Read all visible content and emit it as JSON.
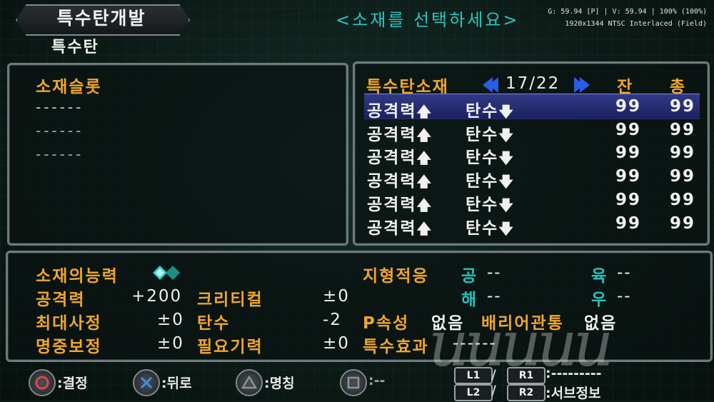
{
  "header": {
    "title": "특수탄개발",
    "subtitle": "특수탄",
    "prompt": "<소재를 선택하세요>",
    "overlay_line1": "G: 59.94 [P] | V: 59.94 | 100% (100%)",
    "overlay_line2": "1920x1344 NTSC Interlaced (Field)"
  },
  "material_slots": {
    "title": "소재슬롯",
    "slots": [
      "------",
      "------",
      "------"
    ]
  },
  "material_list": {
    "title": "특수탄소재",
    "page": "17/22",
    "col_remaining": "잔",
    "col_total": "총",
    "up_arrow": "🡅",
    "down_arrow": "🡇",
    "rows": [
      {
        "stat1": "공격력",
        "stat2": "탄수",
        "remaining": "99",
        "total": "99",
        "selected": true
      },
      {
        "stat1": "공격력",
        "stat2": "탄수",
        "remaining": "99",
        "total": "99",
        "selected": false
      },
      {
        "stat1": "공격력",
        "stat2": "탄수",
        "remaining": "99",
        "total": "99",
        "selected": false
      },
      {
        "stat1": "공격력",
        "stat2": "탄수",
        "remaining": "99",
        "total": "99",
        "selected": false
      },
      {
        "stat1": "공격력",
        "stat2": "탄수",
        "remaining": "99",
        "total": "99",
        "selected": false
      },
      {
        "stat1": "공격력",
        "stat2": "탄수",
        "remaining": "99",
        "total": "99",
        "selected": false
      }
    ]
  },
  "abilities": {
    "title": "소재의능력",
    "attack_label": "공격력",
    "attack_value": "+200",
    "critical_label": "크리티컬",
    "critical_value": "±0",
    "max_range_label": "최대사정",
    "max_range_value": "±0",
    "ammo_label": "탄수",
    "ammo_value": "-2",
    "accuracy_label": "명중보정",
    "accuracy_value": "±0",
    "energy_label": "필요기력",
    "energy_value": "±0",
    "terrain_label": "지형적응",
    "terrain_air_label": "공",
    "terrain_air_value": "--",
    "terrain_land_label": "육",
    "terrain_land_value": "--",
    "terrain_sea_label": "해",
    "terrain_sea_value": "--",
    "terrain_space_label": "우",
    "terrain_space_value": "--",
    "p_attr_label": "P속성",
    "p_attr_value": "없음",
    "barrier_label": "배리어관통",
    "barrier_value": "없음",
    "special_label": "특수효과",
    "special_value": "------"
  },
  "controls": {
    "circle_label": ":결정",
    "cross_label": ":뒤로",
    "triangle_label": ":명칭",
    "square_label": ":--",
    "l1": "L1",
    "r1": "R1",
    "l2": "L2",
    "r2": "R2",
    "slash": "/",
    "r1_label": ":---------",
    "r2_label": ":서브정보"
  },
  "watermark": "uuuuu",
  "colors": {
    "gold": "#f0a72a",
    "cyan": "#22c4bc",
    "selection": "#2b327a",
    "arrow_blue": "#2a5de6"
  }
}
